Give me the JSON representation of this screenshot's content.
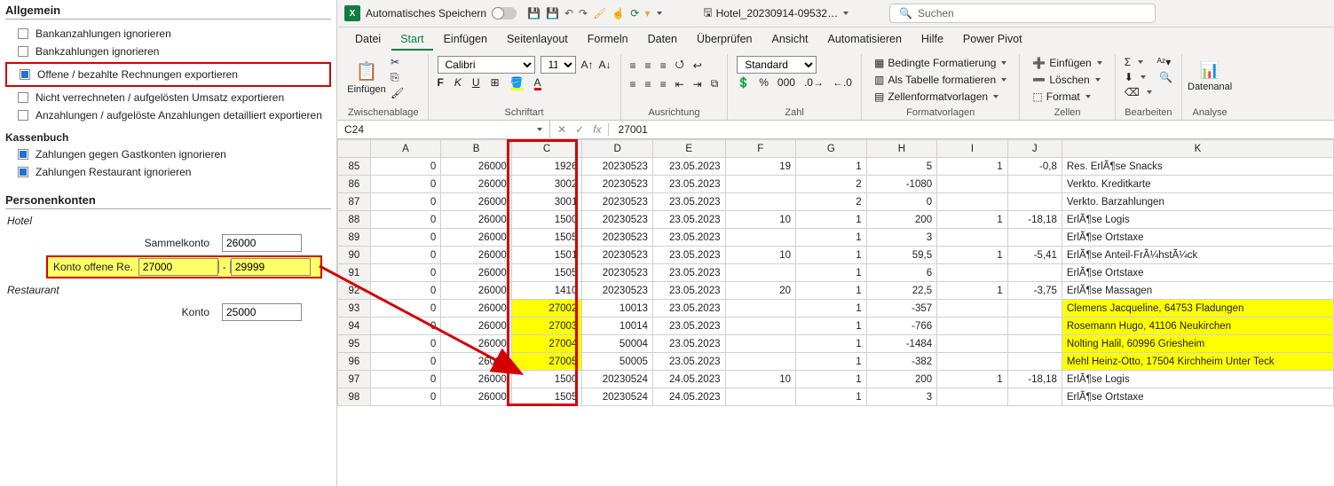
{
  "left": {
    "sec_allgemein": "Allgemein",
    "chk_bankanz": "Bankanzahlungen ignorieren",
    "chk_bankz": "Bankzahlungen ignorieren",
    "chk_offene": "Offene / bezahlte Rechnungen exportieren",
    "chk_nichtver": "Nicht verrechneten / aufgelösten Umsatz exportieren",
    "chk_anz": "Anzahlungen / aufgelöste Anzahlungen detailliert exportieren",
    "sub_kasse": "Kassenbuch",
    "chk_gast": "Zahlungen gegen Gastkonten ignorieren",
    "chk_rest": "Zahlungen Restaurant ignorieren",
    "sec_personen": "Personenkonten",
    "sub_hotel": "Hotel",
    "lbl_sammel": "Sammelkonto",
    "val_sammel": "26000",
    "lbl_kontooff": "Konto offene Re.",
    "val_kontooff_a": "27000",
    "val_kontooff_b": "29999",
    "sub_restaurant": "Restaurant",
    "lbl_konto": "Konto",
    "val_konto": "25000"
  },
  "titlebar": {
    "autosave": "Automatisches Speichern",
    "filename": "Hotel_20230914-09532…",
    "search_ph": "Suchen"
  },
  "tabs": [
    "Datei",
    "Start",
    "Einfügen",
    "Seitenlayout",
    "Formeln",
    "Daten",
    "Überprüfen",
    "Ansicht",
    "Automatisieren",
    "Hilfe",
    "Power Pivot"
  ],
  "ribbon": {
    "paste": "Einfügen",
    "g_clipboard": "Zwischenablage",
    "font_name": "Calibri",
    "font_size": "11",
    "g_font": "Schriftart",
    "g_align": "Ausrichtung",
    "numfmt": "Standard",
    "g_number": "Zahl",
    "r_condfmt": "Bedingte Formatierung",
    "r_tablefmt": "Als Tabelle formatieren",
    "r_cellstyle": "Zellenformatvorlagen",
    "g_styles": "Formatvorlagen",
    "r_insert": "Einfügen",
    "r_delete": "Löschen",
    "r_format": "Format",
    "g_cells": "Zellen",
    "g_edit": "Bearbeiten",
    "g_analysis_btn": "Datenanal",
    "g_analysis": "Analyse"
  },
  "fx": {
    "name": "C24",
    "formula": "27001"
  },
  "cols": [
    "A",
    "B",
    "C",
    "D",
    "E",
    "F",
    "G",
    "H",
    "I",
    "J",
    "K"
  ],
  "rows": [
    {
      "n": 85,
      "a": "0",
      "b": "26000",
      "c": "1926",
      "d": "20230523",
      "e": "23.05.2023",
      "f": "19",
      "g": "1",
      "h": "5",
      "i": "1",
      "j": "-0,8",
      "k": "Res. ErlÃ¶se Snacks"
    },
    {
      "n": 86,
      "a": "0",
      "b": "26000",
      "c": "3002",
      "d": "20230523",
      "e": "23.05.2023",
      "f": "",
      "g": "2",
      "h": "-1080",
      "i": "",
      "j": "",
      "k": "Verkto. Kreditkarte"
    },
    {
      "n": 87,
      "a": "0",
      "b": "26000",
      "c": "3001",
      "d": "20230523",
      "e": "23.05.2023",
      "f": "",
      "g": "2",
      "h": "0",
      "i": "",
      "j": "",
      "k": "Verkto. Barzahlungen"
    },
    {
      "n": 88,
      "a": "0",
      "b": "26000",
      "c": "1500",
      "d": "20230523",
      "e": "23.05.2023",
      "f": "10",
      "g": "1",
      "h": "200",
      "i": "1",
      "j": "-18,18",
      "k": "ErlÃ¶se Logis"
    },
    {
      "n": 89,
      "a": "0",
      "b": "26000",
      "c": "1505",
      "d": "20230523",
      "e": "23.05.2023",
      "f": "",
      "g": "1",
      "h": "3",
      "i": "",
      "j": "",
      "k": "ErlÃ¶se Ortstaxe"
    },
    {
      "n": 90,
      "a": "0",
      "b": "26000",
      "c": "1501",
      "d": "20230523",
      "e": "23.05.2023",
      "f": "10",
      "g": "1",
      "h": "59,5",
      "i": "1",
      "j": "-5,41",
      "k": "ErlÃ¶se Anteil-FrÃ¼hstÃ¼ck"
    },
    {
      "n": 91,
      "a": "0",
      "b": "26000",
      "c": "1505",
      "d": "20230523",
      "e": "23.05.2023",
      "f": "",
      "g": "1",
      "h": "6",
      "i": "",
      "j": "",
      "k": "ErlÃ¶se Ortstaxe"
    },
    {
      "n": 92,
      "a": "0",
      "b": "26000",
      "c": "1410",
      "d": "20230523",
      "e": "23.05.2023",
      "f": "20",
      "g": "1",
      "h": "22,5",
      "i": "1",
      "j": "-3,75",
      "k": "ErlÃ¶se Massagen"
    },
    {
      "n": 93,
      "a": "0",
      "b": "26000",
      "c": "27002",
      "d": "10013",
      "e": "23.05.2023",
      "f": "",
      "g": "1",
      "h": "-357",
      "i": "",
      "j": "",
      "k": "Clemens Jacqueline, 64753 Fladungen",
      "hl": true
    },
    {
      "n": 94,
      "a": "0",
      "b": "26000",
      "c": "27003",
      "d": "10014",
      "e": "23.05.2023",
      "f": "",
      "g": "1",
      "h": "-766",
      "i": "",
      "j": "",
      "k": "Rosemann Hugo, 41106 Neukirchen",
      "hl": true
    },
    {
      "n": 95,
      "a": "0",
      "b": "26000",
      "c": "27004",
      "d": "50004",
      "e": "23.05.2023",
      "f": "",
      "g": "1",
      "h": "-1484",
      "i": "",
      "j": "",
      "k": "Nolting Halil, 60996 Griesheim",
      "hl": true
    },
    {
      "n": 96,
      "a": "0",
      "b": "26000",
      "c": "27005",
      "d": "50005",
      "e": "23.05.2023",
      "f": "",
      "g": "1",
      "h": "-382",
      "i": "",
      "j": "",
      "k": "Mehl Heinz-Otto, 17504 Kirchheim Unter Teck",
      "hl": true
    },
    {
      "n": 97,
      "a": "0",
      "b": "26000",
      "c": "1500",
      "d": "20230524",
      "e": "24.05.2023",
      "f": "10",
      "g": "1",
      "h": "200",
      "i": "1",
      "j": "-18,18",
      "k": "ErlÃ¶se Logis"
    },
    {
      "n": 98,
      "a": "0",
      "b": "26000",
      "c": "1505",
      "d": "20230524",
      "e": "24.05.2023",
      "f": "",
      "g": "1",
      "h": "3",
      "i": "",
      "j": "",
      "k": "ErlÃ¶se Ortstaxe"
    }
  ]
}
